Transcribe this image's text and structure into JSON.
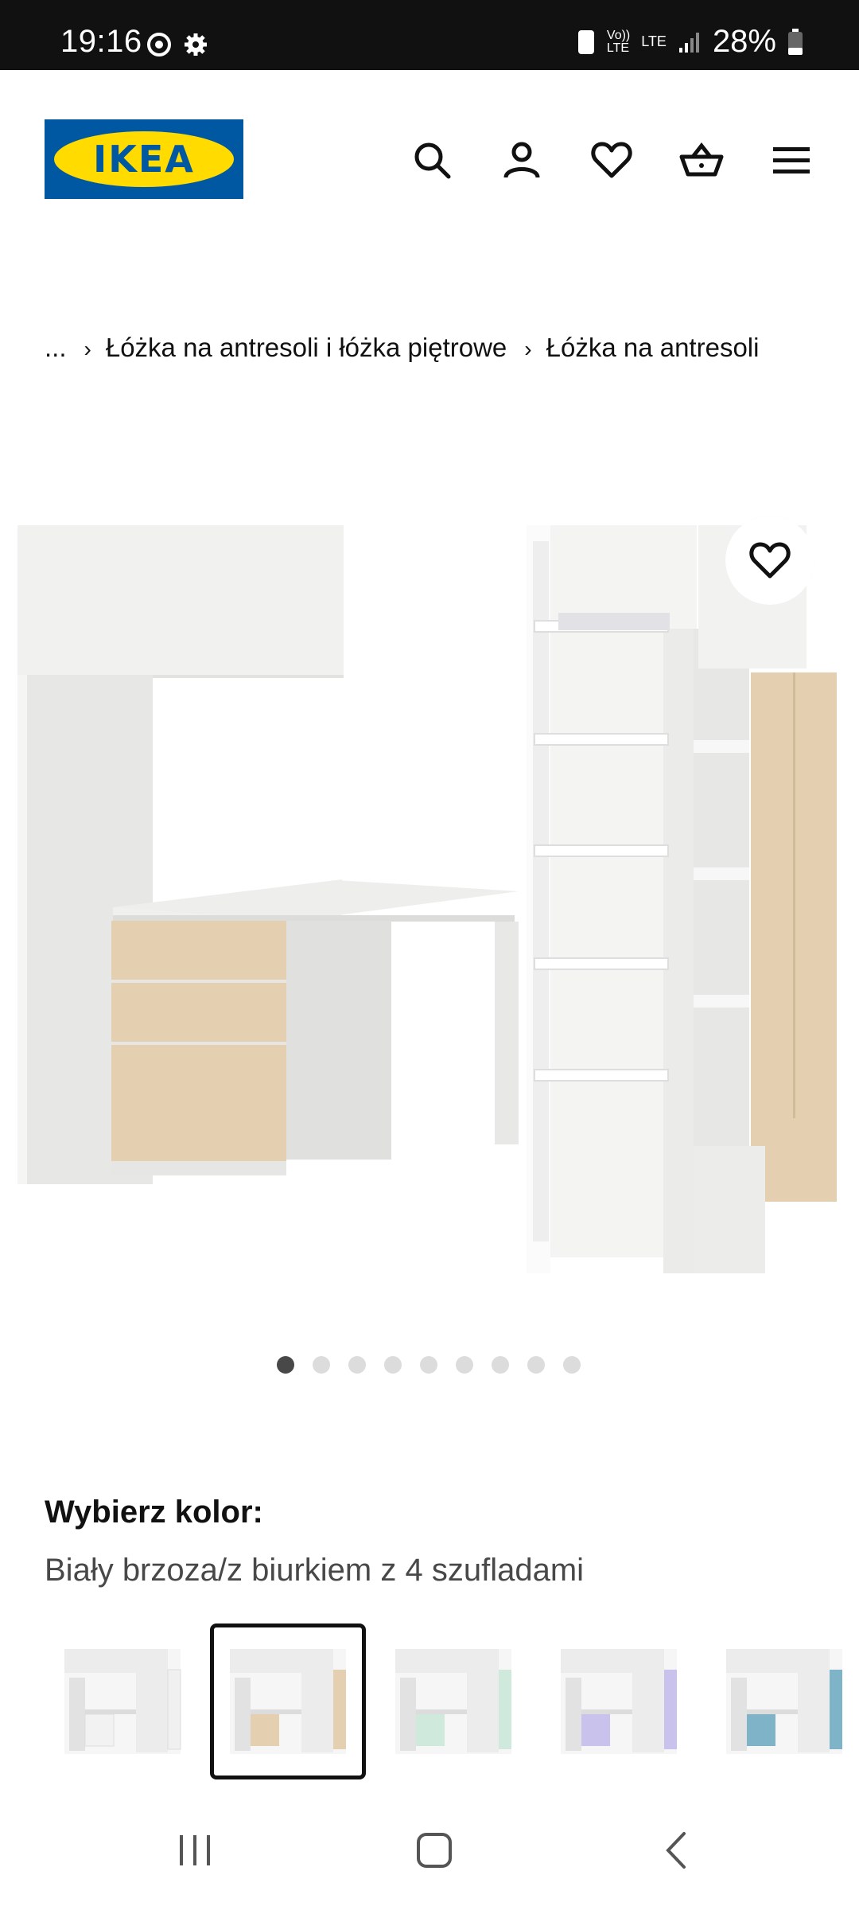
{
  "status_bar": {
    "time": "19:16",
    "battery": "28%",
    "network": "LTE"
  },
  "header": {
    "logo_text": "IKEA",
    "icons": [
      "search-icon",
      "account-icon",
      "wishlist-icon",
      "cart-icon",
      "menu-icon"
    ]
  },
  "breadcrumb": {
    "ellipsis": "...",
    "items": [
      "Łóżka na antresoli i łóżka piętrowe",
      "Łóżka na antresoli"
    ]
  },
  "gallery": {
    "image_count": 9,
    "active_index": 0
  },
  "color_selector": {
    "heading": "Wybierz kolor:",
    "selected_value": "Biały brzoza/z biurkiem z 4 szufladami",
    "swatches": [
      {
        "accent": "#f4f4f4",
        "selected": false
      },
      {
        "accent": "#e4cfb0",
        "selected": true
      },
      {
        "accent": "#cfe9dc",
        "selected": false
      },
      {
        "accent": "#c9c2ec",
        "selected": false
      },
      {
        "accent": "#7fb3c8",
        "selected": false
      }
    ]
  },
  "colors": {
    "ikea_blue": "#0058a3",
    "ikea_yellow": "#ffdb00",
    "birch": "#e4cfb0"
  }
}
